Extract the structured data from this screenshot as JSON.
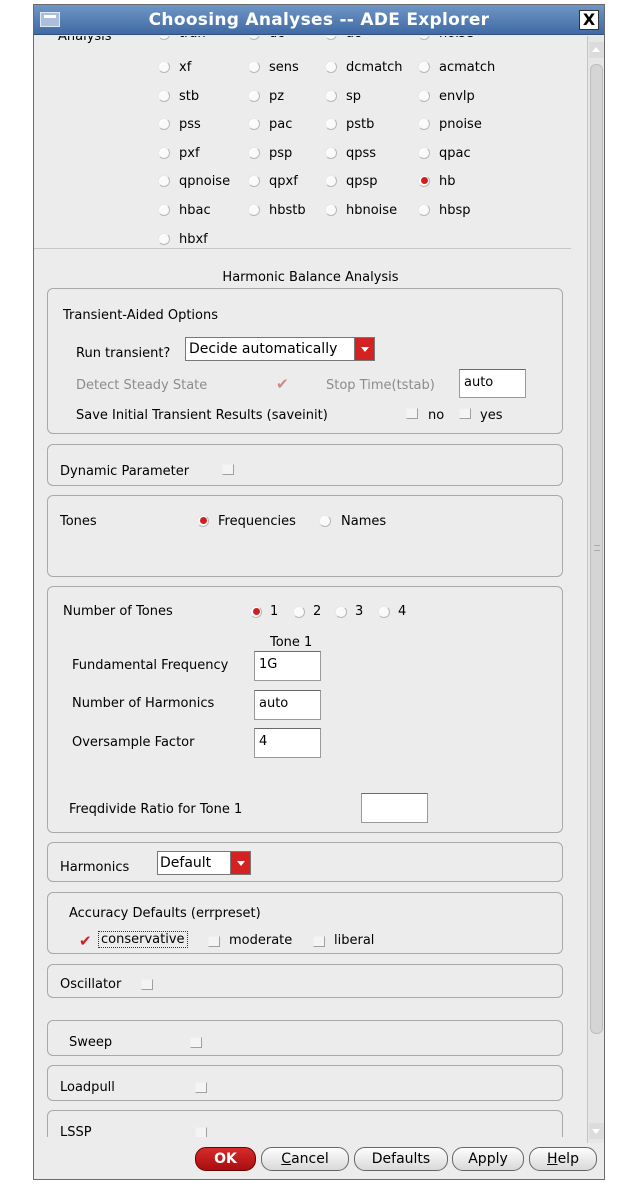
{
  "window": {
    "title": "Choosing Analyses -- ADE Explorer",
    "close": "X"
  },
  "analysis": {
    "label": "Analysis",
    "partial": [
      "tran",
      "dc",
      "ac",
      "noise"
    ],
    "rows": [
      [
        "xf",
        "sens",
        "dcmatch",
        "acmatch"
      ],
      [
        "stb",
        "pz",
        "sp",
        "envlp"
      ],
      [
        "pss",
        "pac",
        "pstb",
        "pnoise"
      ],
      [
        "pxf",
        "psp",
        "qpss",
        "qpac"
      ],
      [
        "qpnoise",
        "qpxf",
        "qpsp",
        "hb"
      ],
      [
        "hbac",
        "hbstb",
        "hbnoise",
        "hbsp"
      ],
      [
        "hbxf"
      ]
    ],
    "selected": "hb"
  },
  "section_title": "Harmonic Balance Analysis",
  "transient": {
    "heading": "Transient-Aided Options",
    "run_label": "Run transient?",
    "run_value": "Decide automatically",
    "detect_label": "Detect Steady State",
    "stop_label": "Stop Time(tstab)",
    "stop_value": "auto",
    "saveinit_label": "Save Initial Transient Results (saveinit)",
    "no": "no",
    "yes": "yes"
  },
  "dynamic": {
    "label": "Dynamic Parameter"
  },
  "tones": {
    "label": "Tones",
    "frequencies": "Frequencies",
    "names": "Names",
    "selected": "Frequencies"
  },
  "numtones": {
    "label": "Number of Tones",
    "options": [
      "1",
      "2",
      "3",
      "4"
    ],
    "selected": "1",
    "column_header": "Tone 1",
    "fund_label": "Fundamental Frequency",
    "fund_value": "1G",
    "harm_label": "Number of Harmonics",
    "harm_value": "auto",
    "os_label": "Oversample Factor",
    "os_value": "4",
    "freqdiv_label": "Freqdivide Ratio for Tone 1",
    "freqdiv_value": ""
  },
  "harmonics": {
    "label": "Harmonics",
    "value": "Default"
  },
  "accuracy": {
    "heading": "Accuracy Defaults (errpreset)",
    "conservative": "conservative",
    "moderate": "moderate",
    "liberal": "liberal",
    "selected": "conservative"
  },
  "oscillator": {
    "label": "Oscillator"
  },
  "sweep": {
    "label": "Sweep"
  },
  "loadpull": {
    "label": "Loadpull"
  },
  "lssp": {
    "label": "LSSP"
  },
  "buttons": {
    "ok": "OK",
    "cancel": "Cancel",
    "defaults": "Defaults",
    "apply": "Apply",
    "help": "Help"
  },
  "colors": {
    "accent_red": "#d21e1e",
    "title_bar": "#4f78ad",
    "dialog_bg": "#ececec"
  }
}
